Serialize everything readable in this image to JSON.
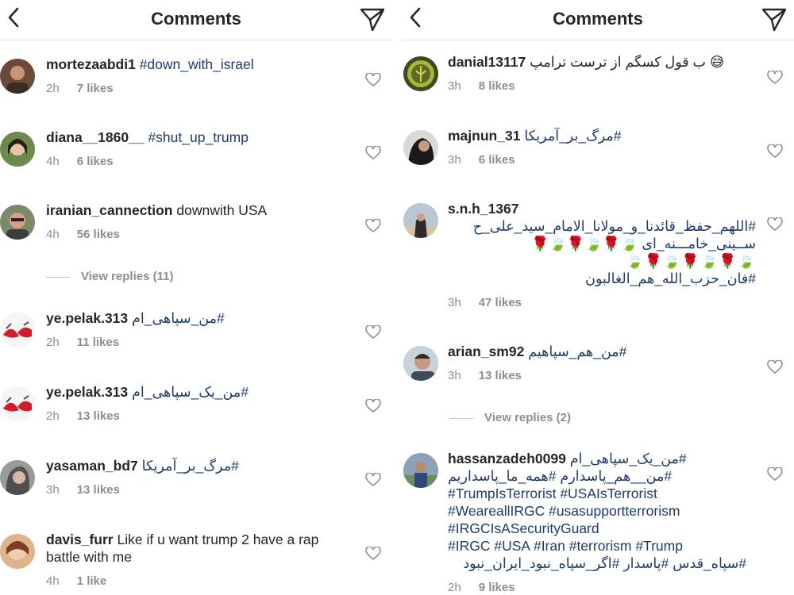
{
  "left": {
    "title": "Comments",
    "comments": [
      {
        "user": "mortezaabdi1",
        "text": "#down_with_israel",
        "time": "2h",
        "likes": "7 likes"
      },
      {
        "user": "diana__1860__",
        "text": "#shut_up_trump",
        "time": "4h",
        "likes": "6 likes"
      },
      {
        "user": "iranian_cannection",
        "text": "downwith USA",
        "time": "4h",
        "likes": "56 likes"
      },
      {
        "user": "ye.pelak.313",
        "text": "#من_سپاهی_ام",
        "time": "2h",
        "likes": "11 likes"
      },
      {
        "user": "ye.pelak.313",
        "text": "#من_یک_سپاهی_ام",
        "time": "2h",
        "likes": "13 likes"
      },
      {
        "user": "yasaman_bd7",
        "text": "#مرگ_بر_آمریکا",
        "time": "3h",
        "likes": "13 likes"
      },
      {
        "user": "davis_furr",
        "text": "Like if u want trump 2 have a rap battle with me",
        "time": "4h",
        "likes": "1 like"
      }
    ],
    "view_replies": "View replies (11)"
  },
  "right": {
    "title": "Comments",
    "comments": [
      {
        "user": "danial13117",
        "text": "ب قول کسگم از ترست ترامپ",
        "emoji": "😅",
        "time": "3h",
        "likes": "8 likes"
      },
      {
        "user": "majnun_31",
        "text": "#مرگ_بر_آمریکا",
        "time": "3h",
        "likes": "6 likes"
      },
      {
        "user": "s.n.h_1367",
        "line1": "#اللهم_حفظ_قائدنا_و_مولانا_الامام_سید_علی_ح",
        "line2": "ســینی_خامـــنه_ای",
        "roses_line1": "🍃🌹🍃🌹🍃🌹",
        "roses_line2": "🍃🌹🍃🌹🍃🌹🍃",
        "line3": "#فان_حزب_الله_هم_الغالبون",
        "time": "3h",
        "likes": "47 likes"
      },
      {
        "user": "arian_sm92",
        "text": "#من_هم_سپاهیم",
        "time": "3h",
        "likes": "13 likes"
      },
      {
        "user": "hassanzadeh0099",
        "text": "#من_یک_سپاهی_ام",
        "lines": [
          "#من__هم_پاسدارم #همه_ما_پاسداریم",
          "#TrumpIsTerrorist #USAIsTerrorist",
          "#WeareallIRGC #usasupportterrorism",
          "#IRGCIsASecurityGuard",
          "#IRGC #USA #Iran  #terrorism #Trump",
          "#سپاه_قدس  #پاسدار #اگر_سپاه_نبود_ایران_نبود"
        ],
        "time": "2h",
        "likes": "9 likes"
      }
    ],
    "view_replies": "View replies (2)"
  },
  "icons": {
    "back": "chevron-left-icon",
    "send": "paper-plane-icon",
    "like": "heart-icon"
  },
  "colors": {
    "hashtag": "#1e3a6d",
    "meta": "#8e8e8e",
    "text": "#262626"
  }
}
